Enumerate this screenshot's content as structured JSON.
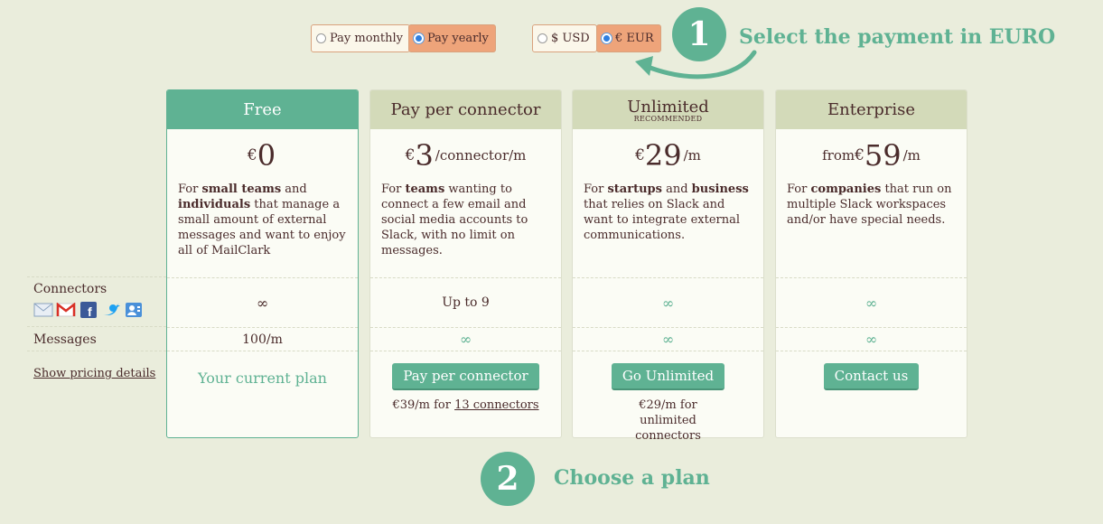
{
  "billing": {
    "monthly": "Pay monthly",
    "yearly": "Pay yearly",
    "selected": "yearly"
  },
  "currency": {
    "usd": "$ USD",
    "eur": "€ EUR",
    "selected": "eur"
  },
  "steps": [
    {
      "number": "1",
      "text": "Select the payment in EURO"
    },
    {
      "number": "2",
      "text": "Choose a plan"
    }
  ],
  "rows": {
    "connectors": "Connectors",
    "messages": "Messages",
    "details_link": "Show pricing details"
  },
  "connector_icons": [
    "mail-icon",
    "gmail-icon",
    "facebook-icon",
    "twitter-icon",
    "contacts-icon"
  ],
  "plans": [
    {
      "name": "Free",
      "badge": "",
      "price_prefix": "",
      "currency": "€",
      "amount": "0",
      "unit": "",
      "desc_html": "For <b>small teams</b> and <b>individuals</b> that manage a small amount of external messages and want to enjoy all of MailClark",
      "connectors": "∞",
      "messages": "100/m",
      "cta": "Your current plan",
      "note_pre": "",
      "note_link": "",
      "note_post": ""
    },
    {
      "name": "Pay per connector",
      "badge": "",
      "price_prefix": "",
      "currency": "€",
      "amount": "3",
      "unit": "/connector/m",
      "desc_html": "For <b>teams</b> wanting to connect a few email and social media accounts to Slack, with no limit on messages.",
      "connectors": "Up to 9",
      "messages": "∞",
      "cta": "Pay per connector",
      "note_pre": "€39/m for ",
      "note_link": "13 connectors",
      "note_post": ""
    },
    {
      "name": "Unlimited",
      "badge": "RECOMMENDED",
      "price_prefix": "",
      "currency": "€",
      "amount": "29",
      "unit": "/m",
      "desc_html": "For <b>startups</b> and <b>business</b> that relies on Slack and want to integrate external communications.",
      "connectors": "∞",
      "messages": "∞",
      "cta": "Go Unlimited",
      "note_pre": "€29/m for unlimited connectors",
      "note_link": "",
      "note_post": ""
    },
    {
      "name": "Enterprise",
      "badge": "",
      "price_prefix": "from ",
      "currency": "€",
      "amount": "59",
      "unit": "/m",
      "desc_html": "For <b>companies</b> that run on multiple Slack workspaces and/or have special needs.",
      "connectors": "∞",
      "messages": "∞",
      "cta": "Contact us",
      "note_pre": "",
      "note_link": "",
      "note_post": ""
    }
  ],
  "colors": {
    "accent": "#5fb293",
    "highlight": "#eea47a",
    "background": "#eaeddc",
    "header": "#d3dab9"
  }
}
